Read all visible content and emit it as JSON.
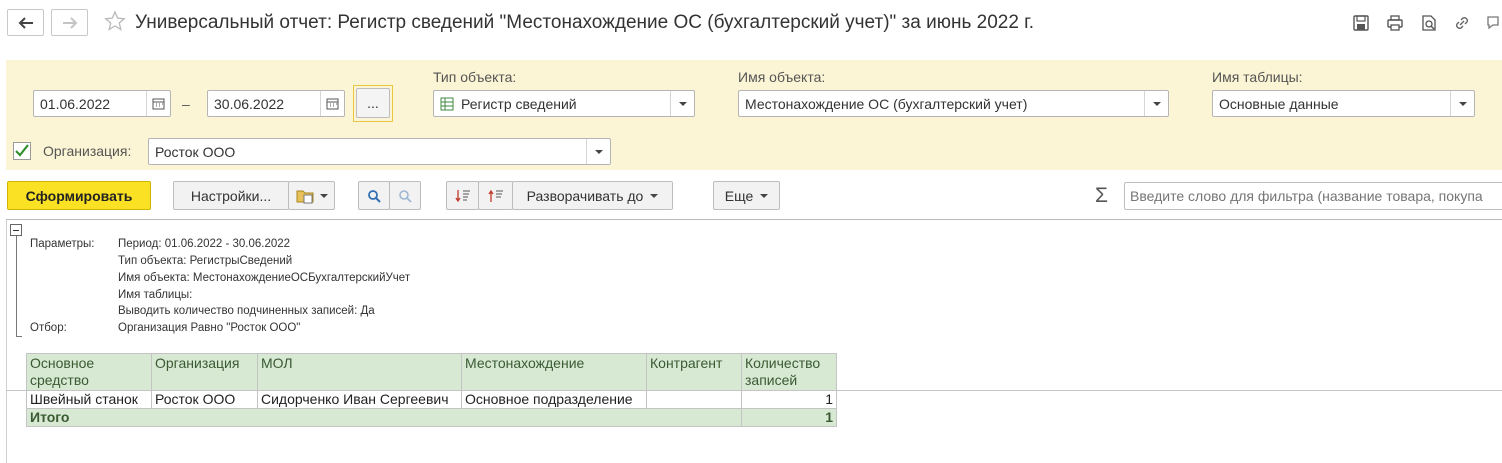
{
  "window": {
    "title": "Универсальный отчет: Регистр сведений \"Местонахождение ОС (бухгалтерский учет)\" за июнь 2022 г."
  },
  "icons": [
    "arrow-left-icon",
    "arrow-right-icon",
    "star-icon",
    "save-icon",
    "print-icon",
    "preview-icon",
    "link-icon",
    "more-icon"
  ],
  "params": {
    "date_from": "01.06.2022",
    "date_dash": "–",
    "date_to": "30.06.2022",
    "period_button": "...",
    "object_type_label": "Тип объекта:",
    "object_type_value": "Регистр сведений",
    "object_name_label": "Имя объекта:",
    "object_name_value": "Местонахождение ОС (бухгалтерский учет)",
    "table_name_label": "Имя таблицы:",
    "table_name_value": "Основные данные",
    "organization_checked": true,
    "organization_label": "Организация:",
    "organization_value": "Росток ООО"
  },
  "toolbar": {
    "generate": "Сформировать",
    "settings": "Настройки...",
    "expand_to": "Разворачивать до",
    "more": "Еще",
    "search_placeholder": "Введите слово для фильтра (название товара, покупа"
  },
  "report": {
    "params_label": "Параметры:",
    "period": "Период: 01.06.2022 - 30.06.2022",
    "object_type": "Тип объекта: РегистрыСведений",
    "object_name": "Имя объекта: МестонахождениеОСБухгалтерскийУчет",
    "table_name": "Имя таблицы:",
    "subordinate": "Выводить количество подчиненных записей: Да",
    "filter_label": "Отбор:",
    "filter_value": "Организация Равно \"Росток ООО\"",
    "columns": [
      "Основное средство",
      "Организация",
      "МОЛ",
      "Местонахождение",
      "Контрагент",
      "Количество записей"
    ],
    "rows": [
      [
        "Швейный станок",
        "Росток ООО",
        "Сидорченко Иван Сергеевич",
        "Основное подразделение",
        "",
        "1"
      ]
    ],
    "total_label": "Итого",
    "total_value": "1"
  },
  "colors": {
    "accent": "#fbe124",
    "panel_bg": "#fbf5d5",
    "header_bg": "#d7e8d3",
    "header_text": "#3a5a32"
  }
}
